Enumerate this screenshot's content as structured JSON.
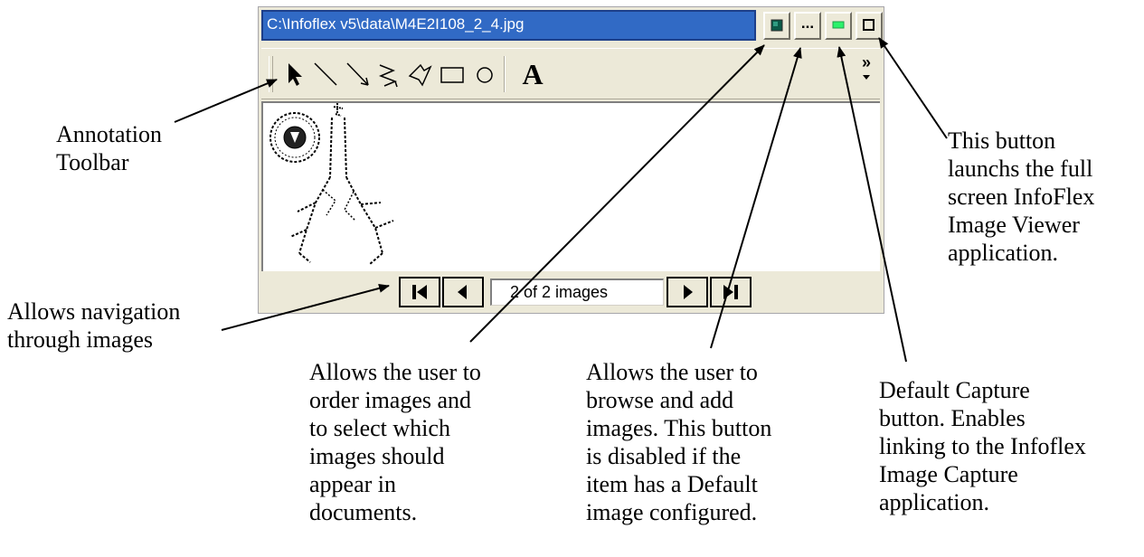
{
  "window": {
    "path": "C:\\Infoflex v5\\data\\M4E2I108_2_4.jpg",
    "title_bar_color": "#316ac5",
    "buttons": [
      {
        "name": "order-images-button",
        "icon": "order-images-icon"
      },
      {
        "name": "browse-add-button",
        "label": "..."
      },
      {
        "name": "default-capture-button",
        "icon": "green-capture-icon",
        "color": "#2cf26b"
      },
      {
        "name": "full-screen-viewer-button",
        "icon": "maximize-icon"
      }
    ]
  },
  "annotation_toolbar": {
    "tools": [
      "select-arrow",
      "line",
      "arrow-line",
      "freehand",
      "polygon",
      "rectangle",
      "ellipse",
      "text"
    ],
    "text_tool_label": "A",
    "overflow_label": "»"
  },
  "navigation": {
    "counter_text": "2 of 2 images",
    "buttons": [
      "first-image",
      "previous-image",
      "next-image",
      "last-image"
    ]
  },
  "callouts": {
    "annotation_toolbar": "Annotation\nToolbar",
    "full_screen": "This button\nlaunchs the full\nscreen InfoFlex\nImage Viewer\napplication.",
    "navigation": "Allows navigation\nthrough images",
    "order_images": "Allows the user to\norder images and\nto select which\nimages should\nappear in\ndocuments.",
    "browse_add": "Allows the user to\nbrowse and add\nimages. This button\nis disabled if the\nitem has a Default\nimage configured.",
    "default_capture": "Default Capture\nbutton. Enables\nlinking to the Infoflex\nImage Capture\napplication."
  }
}
